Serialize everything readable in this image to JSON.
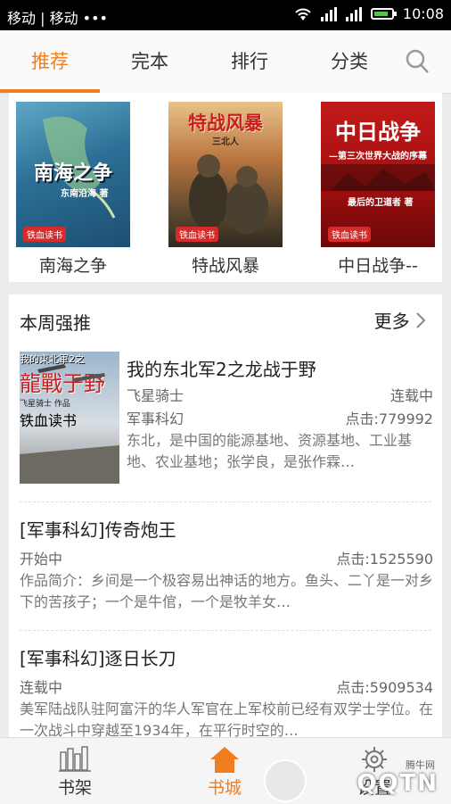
{
  "status_bar": {
    "carrier": "移动 | 移动 •••",
    "time": "10:08",
    "battery_level": 0.85
  },
  "tabs": [
    {
      "label": "推荐",
      "active": true
    },
    {
      "label": "完本",
      "active": false
    },
    {
      "label": "排行",
      "active": false
    },
    {
      "label": "分类",
      "active": false
    }
  ],
  "featured_books": [
    {
      "title": "南海之争",
      "cover_title": "南海之争",
      "cover_author": "东南沿海 著",
      "publisher": "铁血读书"
    },
    {
      "title": "特战风暴",
      "cover_title": "特战风暴",
      "cover_author": "三北人",
      "publisher": "铁血读书"
    },
    {
      "title": "中日战争--",
      "cover_title": "中日战争",
      "cover_subtitle": "—第三次世界大战的序幕",
      "cover_author": "最后的卫道者 著",
      "publisher": "铁血读书"
    }
  ],
  "weekly": {
    "title": "本周强推",
    "more": "更多",
    "top_book": {
      "title": "我的东北军2之龙战于野",
      "cover_title": "我的東北軍2之",
      "cover_big": "龍戰于野",
      "cover_author": "飞星骑士 作品",
      "author": "飞星骑士",
      "status": "连载中",
      "category": "军事科幻",
      "clicks": "点击:779992",
      "description": "东北，是中国的能源基地、资源基地、工业基地、农业基地；张学良，是张作霖…"
    },
    "items": [
      {
        "title": "[军事科幻]传奇炮王",
        "status": "开始中",
        "clicks": "点击:1525590",
        "description": "作品简介：乡间是一个极容易出神话的地方。鱼头、二丫是一对乡下的苦孩子；一个是牛倌，一个是牧羊女…"
      },
      {
        "title": "[军事科幻]逐日长刀",
        "status": "连载中",
        "clicks": "点击:5909534",
        "description": "美军陆战队驻阿富汗的华人军官在上军校前已经有双学士学位。在一次战斗中穿越至1934年，在平行时空的…"
      }
    ]
  },
  "bottom_nav": [
    {
      "label": "书架",
      "icon": "bookshelf-icon",
      "active": false
    },
    {
      "label": "书城",
      "icon": "home-icon",
      "active": true
    },
    {
      "label": "设置",
      "icon": "settings-icon",
      "active": false
    }
  ],
  "watermark": {
    "text": "QQTN",
    "sub": "腾牛网"
  },
  "colors": {
    "accent": "#f07d1e"
  }
}
